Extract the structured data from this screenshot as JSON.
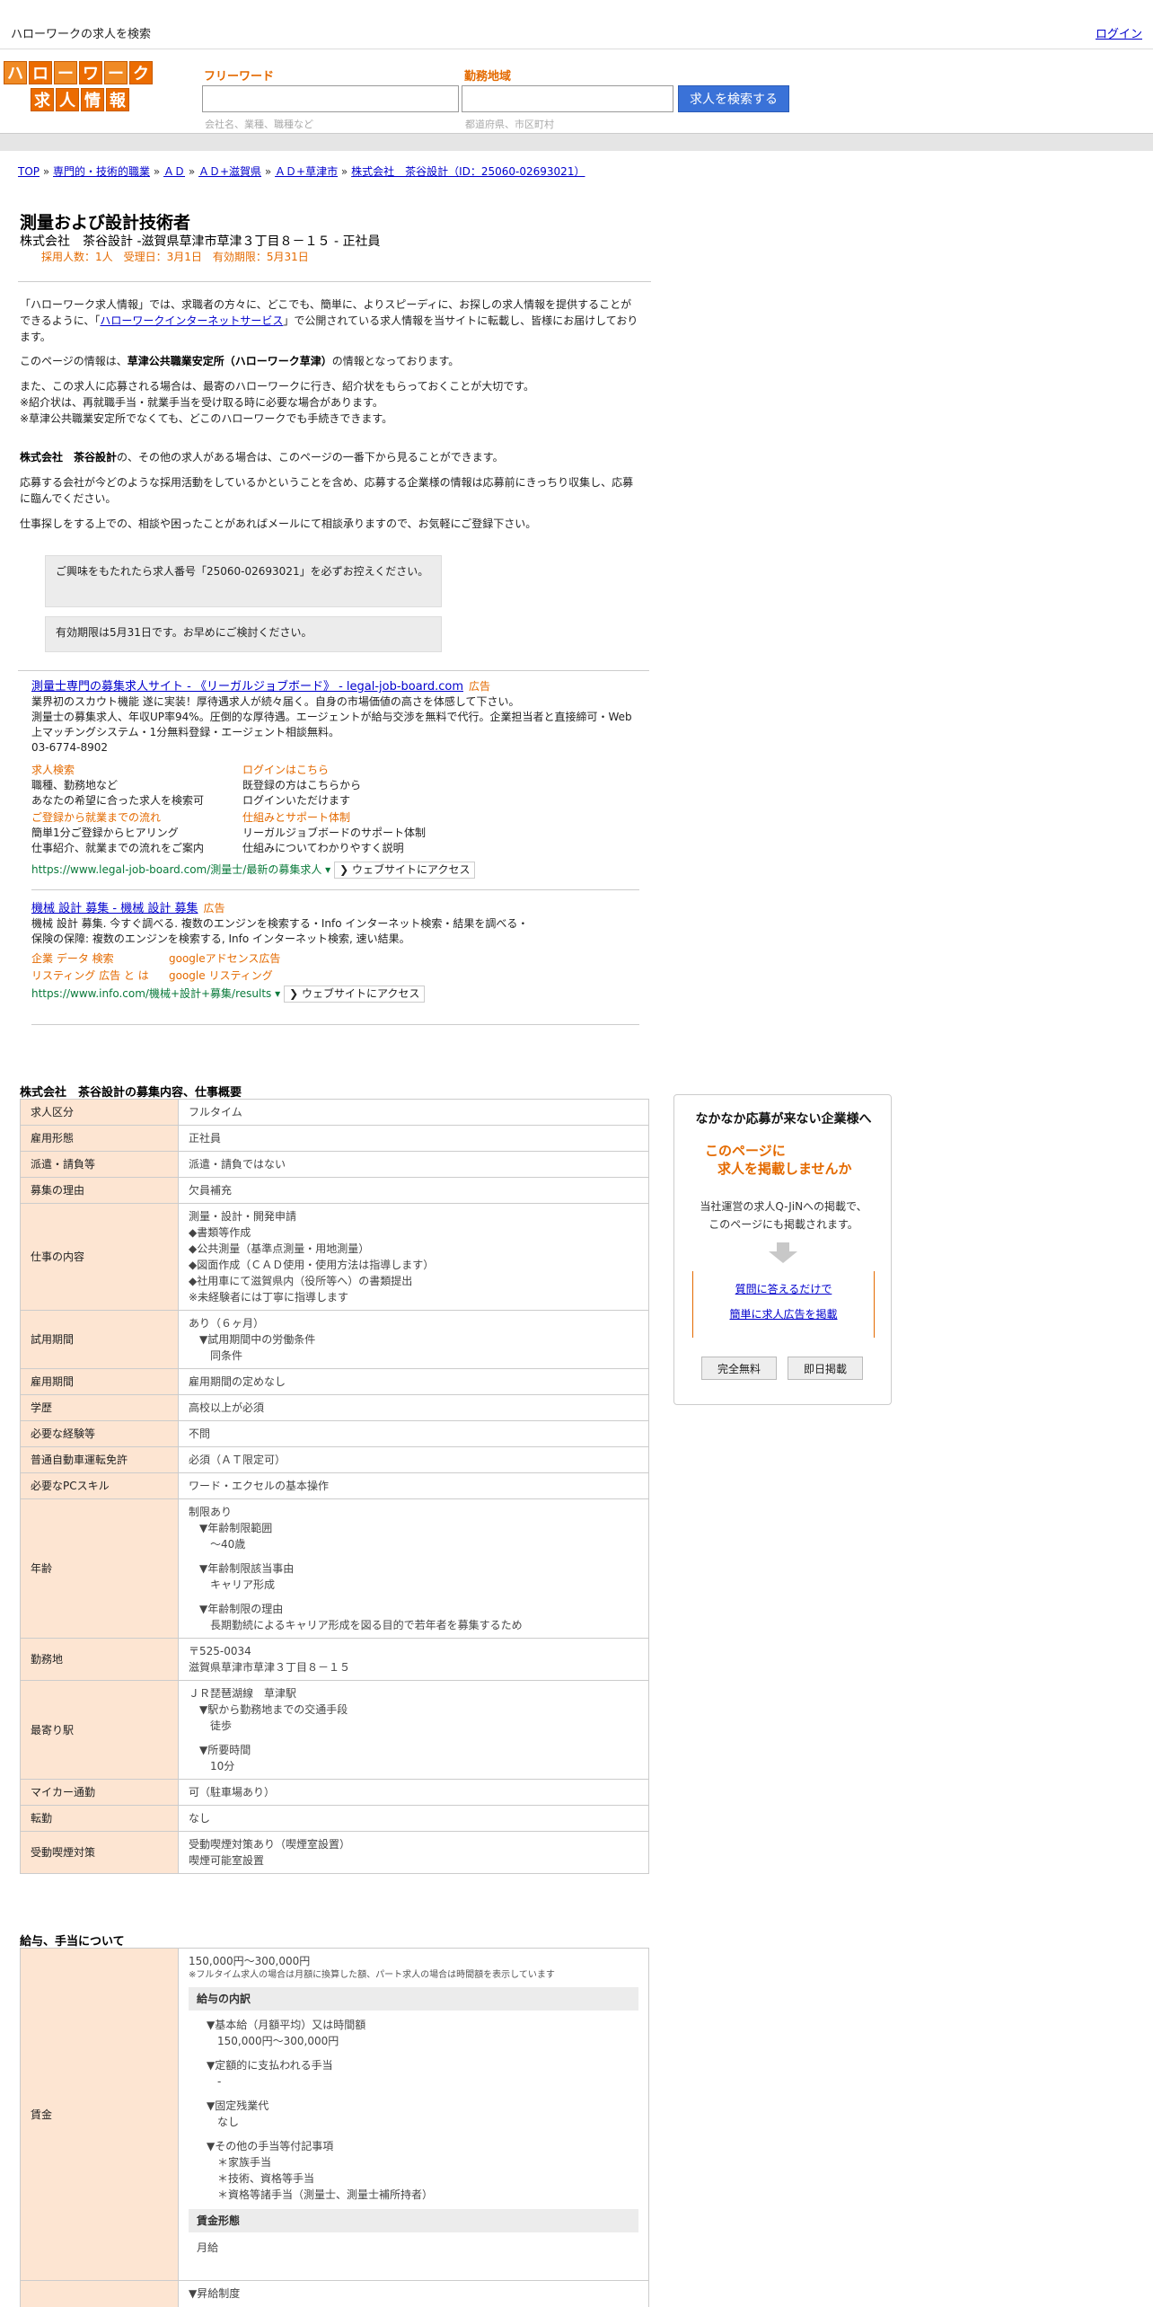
{
  "topbar": {
    "site": "ハローワークの求人を検索",
    "right": "ログイン"
  },
  "logo": {
    "row1": [
      "ハ",
      "ロ",
      "ー",
      "ワ",
      "ー",
      "ク"
    ],
    "row2": [
      "求",
      "人",
      "情",
      "報"
    ]
  },
  "search": {
    "free_label": "フリーワード",
    "free_hint": "会社名、業種、職種など",
    "area_label": "勤務地域",
    "area_hint": "都道府県、市区町村",
    "button": "求人を検索する"
  },
  "breadcrumb": [
    {
      "label": "TOP",
      "sep": " » "
    },
    {
      "label": "専門的・技術的職業",
      "sep": " » "
    },
    {
      "label": "ＡＤ",
      "sep": " » "
    },
    {
      "label": "ＡＤ+滋賀県",
      "sep": " » "
    },
    {
      "label": "ＡＤ+草津市",
      "sep": " » "
    },
    {
      "label": "株式会社　茶谷設計（ID：25060-02693021）",
      "sep": ""
    }
  ],
  "job": {
    "title": "測量および設計技術者",
    "subtitle": "株式会社　茶谷設計 -滋賀県草津市草津３丁目８－１５ - 正社員",
    "meta": "採用人数：1人　受理日：3月1日　有効期限：5月31日"
  },
  "intro": {
    "p1a": "「ハローワーク求人情報」では、求職者の方々に、どこでも、簡単に、よりスピーディに、お探しの求人情報を提供することができるように、「",
    "p1link": "ハローワークインターネットサービス",
    "p1b": "」で公開されている求人情報を当サイトに転載し、皆様にお届けしております。",
    "p2a": "このページの情報は、",
    "p2b": "草津公共職業安定所（ハローワーク草津）",
    "p2c": "の情報となっております。",
    "p3": [
      "また、この求人に応募される場合は、最寄のハローワークに行き、紹介状をもらっておくことが大切です。",
      "※紹介状は、再就職手当・就業手当を受け取る時に必要な場合があります。",
      "※草津公共職業安定所でなくても、どこのハローワークでも手続きできます。"
    ],
    "p4a": "株式会社　茶谷設計",
    "p4b": "の、その他の求人がある場合は、このページの一番下から見ることができます。",
    "p5": "応募する会社が今どのような採用活動をしているかということを含め、応募する企業様の情報は応募前にきっちり収集し、応募に臨んでください。",
    "p6": "仕事探しをする上での、相談や困ったことがあればメールにて相談承りますので、お気軽にご登録下さい。"
  },
  "notices": [
    "ご興味をもたれたら求人番号「25060-02693021」を必ずお控えください。",
    "有効期限は5月31日です。お早めにご検討ください。"
  ],
  "ads": [
    {
      "title": "測量士専門の募集求人サイト - 《リーガルジョブボード》 - legal-job-board.com",
      "label": "広告",
      "desc": [
        "業界初のスカウト機能 遂に実装！厚待遇求人が続々届く。自身の市場価値の高さを体感して下さい。",
        "測量士の募集求人、年収UP率94%。圧倒的な厚待遇。エージェントが給与交渉を無料で代行。企業担当者と直接締可・Web上マッチングシステム・1分無料登録・エージェント相談無料。"
      ],
      "phone": "03-6774-8902",
      "links": [
        {
          "t": "求人検索",
          "d": [
            "職種、勤務地など",
            "あなたの希望に合った求人を検索可"
          ]
        },
        {
          "t": "ログインはこちら",
          "d": [
            "既登録の方はこちらから",
            "ログインいただけます"
          ]
        },
        {
          "t": "ご登録から就業までの流れ",
          "d": [
            "簡単1分ご登録からヒアリング",
            "仕事紹介、就業までの流れをご案内"
          ]
        },
        {
          "t": "仕組みとサポート体制",
          "d": [
            "リーガルジョブボードのサポート体制",
            "仕組みについてわかりやすく説明"
          ]
        }
      ],
      "url": "https://www.legal-job-board.com/測量士/最新の募集求人 ▾",
      "visit": "❯ ウェブサイトにアクセス"
    },
    {
      "title": "機械 設計 募集 - 機械 設計 募集",
      "label": "広告",
      "desc": [
        "機械 設計 募集. 今すぐ調べる. 複数のエンジンを検索する・Info インターネット検索・結果を調べる・",
        "保険の保障: 複数のエンジンを検索する, Info インターネット検索, 速い結果。"
      ],
      "sublinks": [
        [
          "企業 データ 検索",
          "googleアドセンス広告"
        ],
        [
          "リスティング 広告 と は",
          "google リスティング"
        ]
      ],
      "url": "https://www.info.com/機械+設計+募集/results ▾",
      "visit": "❯ ウェブサイトにアクセス"
    }
  ],
  "section1_title": "株式会社　茶谷設計の募集内容、仕事概要",
  "rows": [
    {
      "k": "求人区分",
      "v": [
        "フルタイム"
      ]
    },
    {
      "k": "雇用形態",
      "v": [
        "正社員"
      ]
    },
    {
      "k": "派遣・請負等",
      "v": [
        "派遣・請負ではない"
      ]
    },
    {
      "k": "募集の理由",
      "v": [
        "欠員補充"
      ]
    },
    {
      "k": "仕事の内容",
      "v": [
        "測量・設計・開発申請",
        "◆書類等作成",
        "◆公共測量（基準点測量・用地測量）",
        "◆図面作成（ＣＡＤ使用・使用方法は指導します）",
        "◆社用車にて滋賀県内（役所等へ）の書類提出",
        "※未経験者には丁寧に指導します"
      ]
    },
    {
      "k": "試用期間",
      "v": [
        "あり（６ヶ月）",
        "　▼試用期間中の労働条件",
        "　　同条件"
      ]
    },
    {
      "k": "雇用期間",
      "v": [
        "雇用期間の定めなし"
      ]
    },
    {
      "k": "学歴",
      "v": [
        "高校以上が必須"
      ]
    },
    {
      "k": "必要な経験等",
      "v": [
        "不問"
      ]
    },
    {
      "k": "普通自動車運転免許",
      "v": [
        "必須（ＡＴ限定可）"
      ]
    },
    {
      "k": "必要なPCスキル",
      "v": [
        "ワード・エクセルの基本操作"
      ]
    },
    {
      "k": "年齢",
      "v": [
        "制限あり",
        "　▼年齢制限範囲",
        "　　〜40歳",
        "",
        "　▼年齢制限該当事由",
        "　　キャリア形成",
        "",
        "　▼年齢制限の理由",
        "　　長期勤続によるキャリア形成を図る目的で若年者を募集するため"
      ]
    },
    {
      "k": "勤務地",
      "v": [
        "〒525-0034",
        "滋賀県草津市草津３丁目８－１５"
      ]
    },
    {
      "k": "最寄り駅",
      "v": [
        "ＪＲ琵琶湖線　草津駅",
        "　▼駅から勤務地までの交通手段",
        "　　徒歩",
        "",
        "　▼所要時間",
        "　　10分"
      ]
    },
    {
      "k": "マイカー通勤",
      "v": [
        "可（駐車場あり）"
      ]
    },
    {
      "k": "転勤",
      "v": [
        "なし"
      ]
    },
    {
      "k": "受動喫煙対策",
      "v": [
        "受動喫煙対策あり（喫煙室設置）",
        "喫煙可能室設置"
      ]
    }
  ],
  "section2_title": "給与、手当について",
  "salary": {
    "k": "賃金",
    "range": "150,000円〜300,000円",
    "note": "※フルタイム求人の場合は月額に換算した額、パート求人の場合は時間額を表示しています",
    "breakdown_title": "給与の内訳",
    "breakdown": [
      "▼基本給（月額平均）又は時間額",
      "　150,000円〜300,000円",
      "",
      "▼定額的に支払われる手当",
      "　-",
      "",
      "▼固定残業代",
      "　なし",
      "",
      "▼その他の手当等付記事項",
      "　＊家族手当",
      "　＊技術、資格等手当",
      "　＊資格等諸手当（測量士、測量士補所持者）"
    ],
    "form_title": "賃金形態",
    "form": "月給",
    "next": "▼昇給制度"
  },
  "side": {
    "heading": "なかなか応募が来ない企業様へ",
    "offer1": "このページに",
    "offer2": "求人を掲載しませんか",
    "desc1": "当社運営の求人Q-JiNへの掲載で、",
    "desc2": "このページにも掲載されます。",
    "link1": "質問に答えるだけで",
    "link2": "簡単に求人広告を掲載",
    "btn1": "完全無料",
    "btn2": "即日掲載"
  },
  "colors": {
    "accent": "#e46a00",
    "link": "#0000cc",
    "key_bg": "#fde5d2",
    "button": "#3a72d8"
  }
}
